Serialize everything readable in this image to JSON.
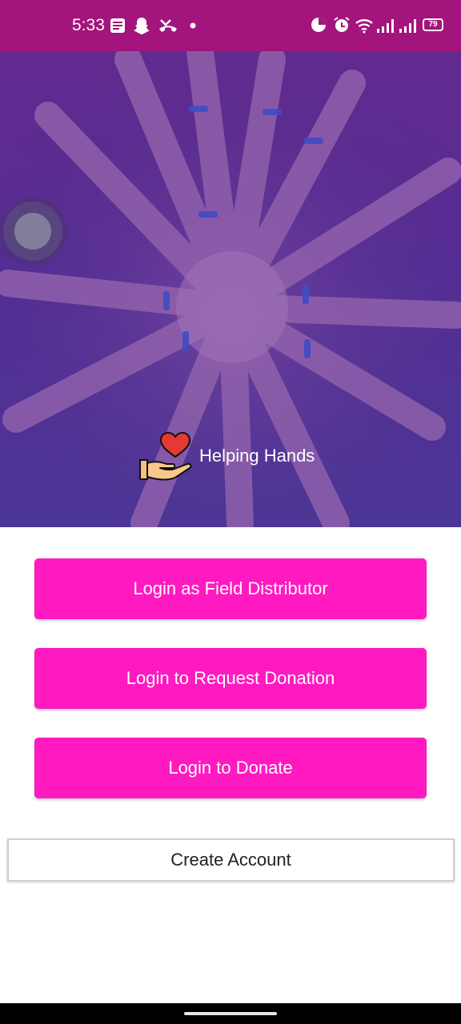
{
  "status_bar": {
    "time": "5:33",
    "battery": "79",
    "left_icons": [
      "message-icon",
      "snapchat-icon",
      "missed-call-icon",
      "dot-icon"
    ],
    "right_icons": [
      "data-saver-icon",
      "alarm-icon",
      "wifi-icon",
      "signal-icon",
      "signal-icon"
    ]
  },
  "hero": {
    "app_name": "Helping Hands",
    "logo_icon": "heart-in-hand-icon"
  },
  "buttons": {
    "field_distributor": "Login as Field Distributor",
    "request_donation": "Login to Request Donation",
    "donate": "Login to Donate",
    "create_account": "Create Account"
  },
  "colors": {
    "status_bar": "#a3157c",
    "primary_button": "#ff19c0",
    "hero_overlay": "#5a2d96"
  }
}
